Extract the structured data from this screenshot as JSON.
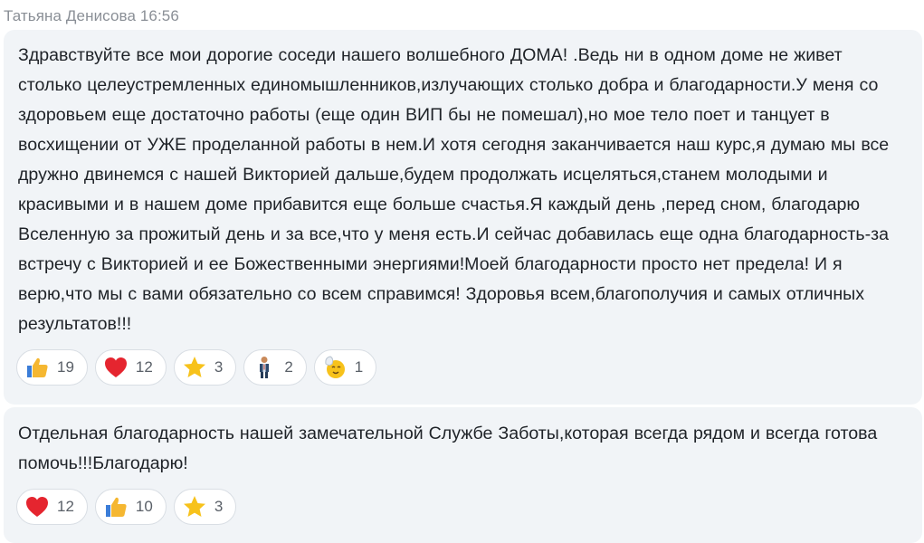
{
  "header": {
    "sender_name": "Татьяна Денисова",
    "time": "16:56"
  },
  "messages": [
    {
      "text": "Здравствуйте все мои дорогие соседи нашего волшебного ДОМА! .Ведь ни в одном доме не живет столько целеустремленных единомышленников,излучающих столько добра и благодарности.У меня со здоровьем еще достаточно работы (еще один ВИП бы не помешал),но мое тело поет и танцует в восхищении от УЖЕ проделанной работы в нем.И хотя сегодня заканчивается наш курс,я думаю мы все дружно двинемся с нашей Викторией дальше,будем  продолжать исцеляться,станем молодыми и красивыми и в нашем доме прибавится еще больше счастья.Я каждый день ,перед сном, благодарю Вселенную за прожитый день и за все,что у меня есть.И сейчас добавилась еще одна благодарность-за встречу с Викторией и ее Божественными энергиями!Моей благодарности просто нет предела! И я верю,что мы с вами обязательно со всем справимся! Здоровья всем,благополучия и самых отличных результатов!!!",
      "reactions": [
        {
          "icon": "thumbs-up-icon",
          "count": "19"
        },
        {
          "icon": "heart-icon",
          "count": "12"
        },
        {
          "icon": "star-icon",
          "count": "3"
        },
        {
          "icon": "person-icon",
          "count": "2"
        },
        {
          "icon": "praying-face-icon",
          "count": "1"
        }
      ]
    },
    {
      "text": "Отдельная благодарность нашей замечательной Службе Заботы,которая всегда рядом и всегда готова помочь!!!Благодарю!",
      "reactions": [
        {
          "icon": "heart-icon",
          "count": "12"
        },
        {
          "icon": "thumbs-up-icon",
          "count": "10"
        },
        {
          "icon": "star-icon",
          "count": "3"
        }
      ]
    }
  ],
  "colors": {
    "bubble_bg": "#f1f4f7",
    "text": "#1f2328",
    "meta": "#8a8f96",
    "heart": "#e5252f",
    "thumb": "#f5b731",
    "star": "#f7c21b"
  }
}
